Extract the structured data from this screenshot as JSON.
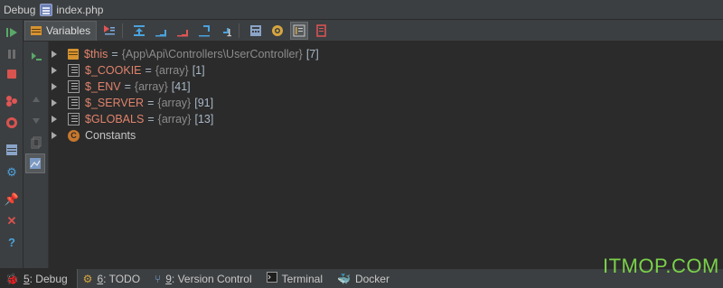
{
  "titlebar": {
    "label": "Debug",
    "file": "index.php"
  },
  "left_toolbar": {
    "icons": [
      "resume-icon",
      "pause-icon",
      "stop-icon",
      "view-breakpoints-icon",
      "mute-breakpoints-icon",
      "layout-icon",
      "settings-icon",
      "pin-icon",
      "close-icon",
      "help-icon"
    ]
  },
  "frames": {
    "icons": [
      "step-into-frame-icon",
      "up-icon",
      "down-icon",
      "copy-icon",
      "image-icon"
    ]
  },
  "header": {
    "tab_label": "Variables",
    "toolbar_icons": [
      "show-execution-point-icon",
      "step-over-icon",
      "step-into-icon",
      "force-step-into-icon",
      "step-out-icon",
      "run-to-cursor-icon",
      "evaluate-expression-icon",
      "watch-icon",
      "frames-toggle-icon",
      "restore-layout-icon"
    ]
  },
  "variables": [
    {
      "name": "$this",
      "eq": "=",
      "type": "{App\\Api\\Controllers\\UserController}",
      "count": "[7]",
      "icon": "object"
    },
    {
      "name": "$_COOKIE",
      "eq": "=",
      "type": "{array}",
      "count": "[1]",
      "icon": "array"
    },
    {
      "name": "$_ENV",
      "eq": "=",
      "type": "{array}",
      "count": "[41]",
      "icon": "array"
    },
    {
      "name": "$_SERVER",
      "eq": "=",
      "type": "{array}",
      "count": "[91]",
      "icon": "array"
    },
    {
      "name": "$GLOBALS",
      "eq": "=",
      "type": "{array}",
      "count": "[13]",
      "icon": "array"
    }
  ],
  "constants": {
    "label": "Constants",
    "badge": "C"
  },
  "bottom_tabs": [
    {
      "num": "5",
      "label": ": Debug",
      "icon": "bug-icon",
      "active": true
    },
    {
      "num": "6",
      "label": ": TODO",
      "icon": "todo-icon",
      "active": false
    },
    {
      "num": "9",
      "label": ": Version Control",
      "icon": "vcs-icon",
      "active": false
    },
    {
      "num": "",
      "label": "Terminal",
      "icon": "terminal-icon",
      "active": false
    },
    {
      "num": "",
      "label": "Docker",
      "icon": "docker-icon",
      "active": false
    }
  ],
  "watermark": "ITMOP.COM",
  "colors": {
    "accent_green": "#7ad14a",
    "var_name": "#e0836c",
    "object_icon": "#d69230"
  }
}
